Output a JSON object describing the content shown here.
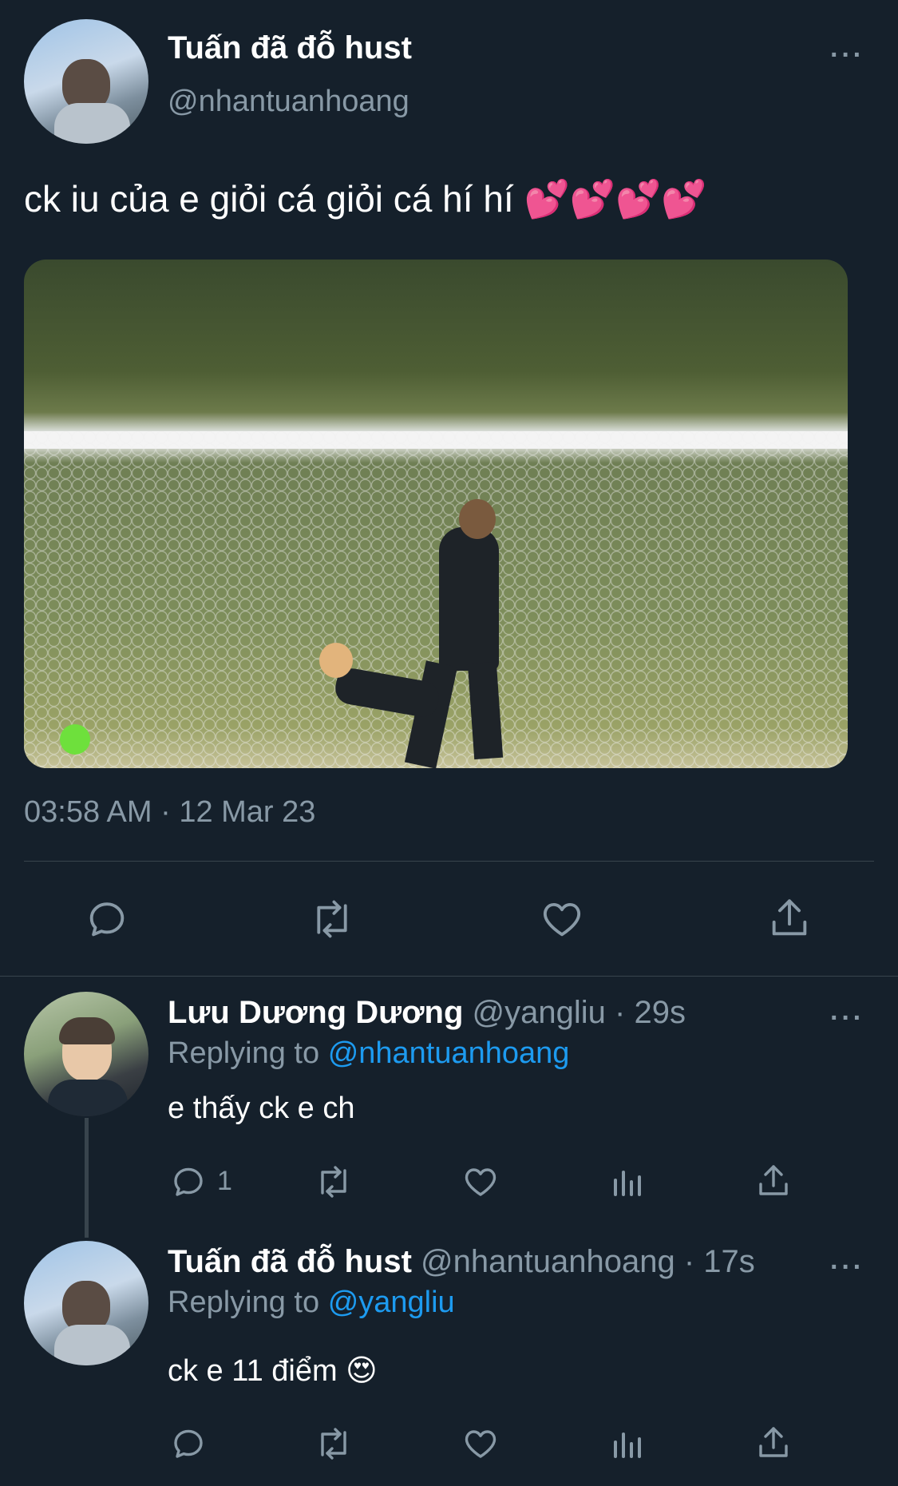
{
  "tweet": {
    "author_name": "Tuấn đã đỗ hust",
    "author_handle": "@nhantuanhoang",
    "text": "ck iu của e giỏi cá giỏi cá hí hí 💕💕💕💕",
    "timestamp": "03:58 AM · 12 Mar 23"
  },
  "replies": [
    {
      "author_name": "Lưu Dương Dương",
      "author_handle": "@yangliu",
      "separator": "·",
      "time": "29s",
      "replying_prefix": "Replying to",
      "replying_to": "@nhantuanhoang",
      "text": "e thấy ck e ch",
      "reply_count": "1"
    },
    {
      "author_name": "Tuấn đã đỗ hust",
      "author_handle": "@nhantuanhoang",
      "separator": "·",
      "time": "17s",
      "replying_prefix": "Replying to",
      "replying_to": "@yangliu",
      "text": "ck e 11 điểm 😍",
      "reply_count": ""
    }
  ],
  "icons": {
    "more": "···",
    "reply": "reply-icon",
    "retweet": "retweet-icon",
    "like": "heart-icon",
    "share": "share-icon",
    "analytics": "analytics-icon"
  },
  "colors": {
    "background": "#15202b",
    "muted": "#8899a6",
    "link": "#1d9bf0",
    "divider": "#38444d"
  }
}
